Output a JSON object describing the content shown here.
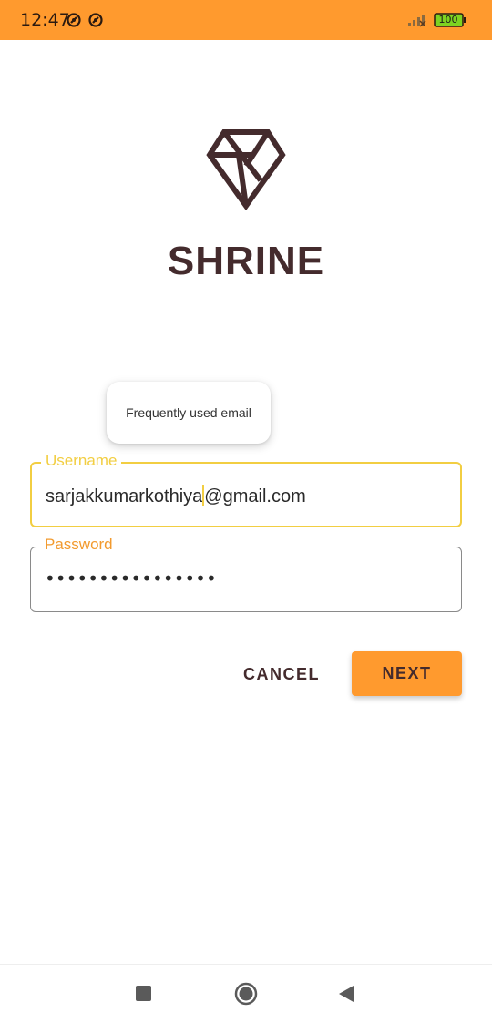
{
  "status_bar": {
    "time": "12:47",
    "battery": "100",
    "background_color": "#FF9A2E"
  },
  "brand": {
    "title": "SHRINE",
    "logo_icon": "diamond-icon",
    "color": "#442B2D"
  },
  "autofill": {
    "suggestion": "Frequently used email"
  },
  "login_form": {
    "username_label": "Username",
    "username_value": "sarjakkumarkothiya@gmail.com",
    "username_value_before_cursor": "sarjakkumarkothiya",
    "username_value_after_cursor": "@gmail.com",
    "password_label": "Password",
    "password_value": "••••••••••••••••",
    "focus_color": "#F2CE42",
    "label_color": "#F29A2E"
  },
  "actions": {
    "cancel_label": "CANCEL",
    "next_label": "NEXT",
    "accent_color": "#FF9A2E"
  },
  "nav_bar": {
    "recents_icon": "square-recents-icon",
    "home_icon": "circle-home-icon",
    "back_icon": "triangle-back-icon"
  }
}
